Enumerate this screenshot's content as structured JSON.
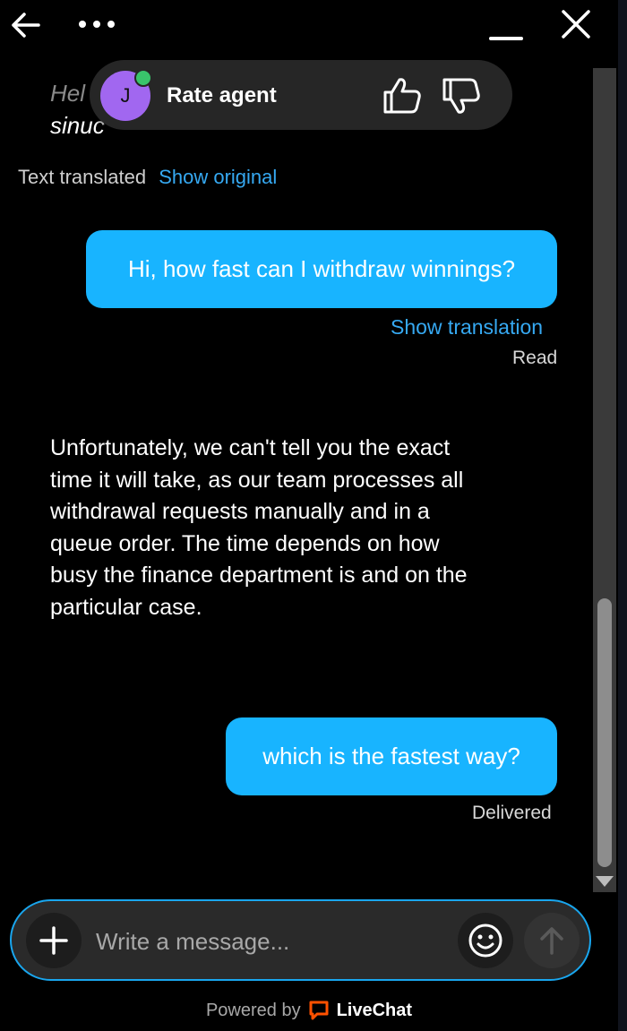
{
  "header": {
    "back_icon": "arrow-left-icon",
    "more_icon": "more-dots-icon",
    "minimize_icon": "minimize-icon",
    "close_icon": "close-icon"
  },
  "previous_message": {
    "line1": "Hel",
    "line2": "sinuc"
  },
  "rate_agent": {
    "avatar_initial": "J",
    "label": "Rate agent",
    "thumbs_up_icon": "thumbs-up-icon",
    "thumbs_down_icon": "thumbs-down-icon",
    "status_color": "#39c46b"
  },
  "translation_meta": {
    "text": "Text translated",
    "link": "Show original"
  },
  "messages": [
    {
      "from": "visitor",
      "text": "Hi, how fast can I withdraw winnings?",
      "link": "Show translation",
      "status": "Read"
    },
    {
      "from": "agent",
      "text": "Unfortunately, we can't tell you the exact time it will take, as our team processes all withdrawal requests manually and in a queue order. The time depends on how busy the finance department is and on the particular case."
    },
    {
      "from": "visitor",
      "text": "which is the fastest way?",
      "status": "Delivered"
    }
  ],
  "composer": {
    "placeholder": "Write a message...",
    "add_icon": "plus-icon",
    "emoji_icon": "emoji-icon",
    "send_icon": "send-arrow-icon"
  },
  "footer": {
    "powered_by": "Powered by",
    "brand": "LiveChat"
  },
  "colors": {
    "accent": "#18b4ff",
    "link": "#36a9f2",
    "brand_icon": "#ff5100",
    "background": "#000000"
  }
}
